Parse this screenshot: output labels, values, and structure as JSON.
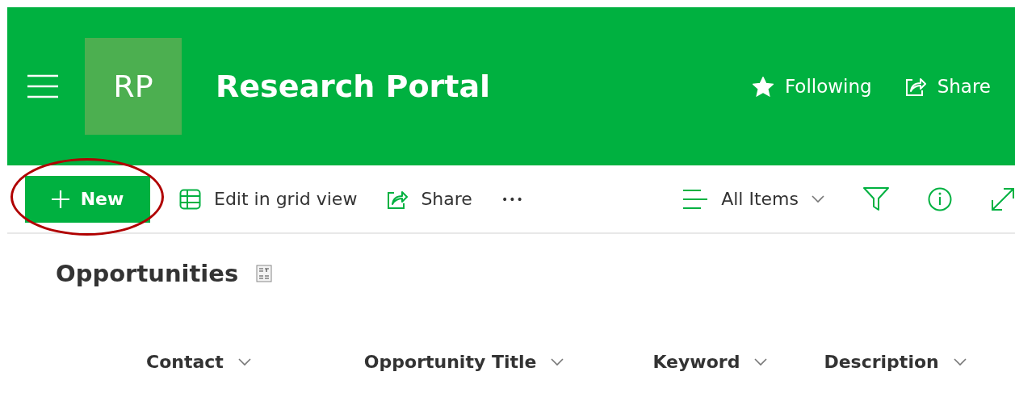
{
  "site": {
    "logo": "RP",
    "title": "Research Portal",
    "following": true,
    "actions": [
      {
        "kind": "follow",
        "label": "Following"
      },
      {
        "kind": "share",
        "label": "Share"
      }
    ]
  },
  "command_bar": {
    "new_label": "New",
    "highlighted": true,
    "commands": [
      {
        "kind": "grid",
        "label": "Edit in grid view"
      },
      {
        "kind": "share",
        "label": "Share"
      },
      {
        "kind": "more",
        "label": "•••"
      }
    ],
    "view": {
      "label": "All Items"
    }
  },
  "list": {
    "title": "Opportunities",
    "columns": [
      "Contact",
      "Opportunity Title",
      "Keyword",
      "Description"
    ]
  }
}
